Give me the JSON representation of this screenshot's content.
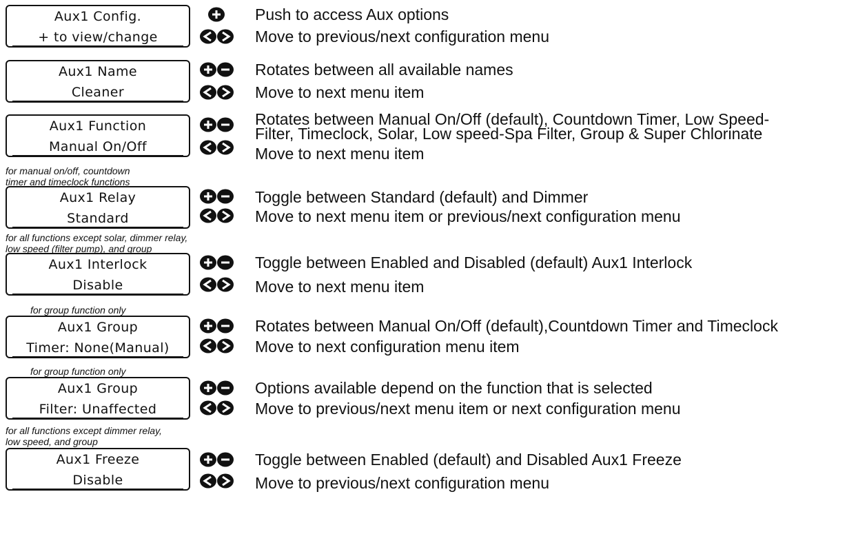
{
  "sections": [
    {
      "note": [],
      "display": {
        "line1": "Aux1 Config.",
        "line2": "+ to view/change"
      },
      "buttons_top": [
        "plus-icon"
      ],
      "desc_top": [
        "Push to access Aux options"
      ],
      "buttons_bottom": [
        "prev-icon",
        "next-icon"
      ],
      "desc_bottom": "Move to previous/next configuration menu"
    },
    {
      "note": [],
      "display": {
        "line1": "Aux1 Name",
        "line2": "Cleaner"
      },
      "buttons_top": [
        "plus-icon",
        "minus-icon"
      ],
      "desc_top": [
        "Rotates between all available names"
      ],
      "buttons_bottom": [
        "prev-icon",
        "next-icon"
      ],
      "desc_bottom": "Move to next menu item"
    },
    {
      "note": [],
      "display": {
        "line1": "Aux1 Function",
        "line2": "Manual On/Off"
      },
      "buttons_top": [
        "plus-icon",
        "minus-icon"
      ],
      "desc_top": [
        "Rotates between Manual On/Off (default), Countdown Timer, Low Speed-",
        "Filter, Timeclock, Solar, Low speed-Spa Filter, Group & Super Chlorinate"
      ],
      "buttons_bottom": [
        "prev-icon",
        "next-icon"
      ],
      "desc_bottom": "Move to next menu item"
    },
    {
      "note": [
        "for manual on/off, countdown",
        "timer and timeclock functions"
      ],
      "display": {
        "line1": "Aux1 Relay",
        "line2": "Standard"
      },
      "buttons_top": [
        "plus-icon",
        "minus-icon"
      ],
      "desc_top": [
        "Toggle between Standard (default) and Dimmer"
      ],
      "buttons_bottom": [
        "prev-icon",
        "next-icon"
      ],
      "desc_bottom": "Move to next menu item or previous/next configuration menu"
    },
    {
      "note": [
        "for all functions except solar, dimmer relay,",
        "low speed (filter pump), and group"
      ],
      "display": {
        "line1": "Aux1 Interlock",
        "line2": "Disable"
      },
      "buttons_top": [
        "plus-icon",
        "minus-icon"
      ],
      "desc_top": [
        "Toggle between Enabled and Disabled (default) Aux1 Interlock"
      ],
      "buttons_bottom": [
        "prev-icon",
        "next-icon"
      ],
      "desc_bottom": "Move to next menu item"
    },
    {
      "note": [
        "for group function only"
      ],
      "display": {
        "line1": "Aux1 Group",
        "line2": "Timer: None(Manual)"
      },
      "buttons_top": [
        "plus-icon",
        "minus-icon"
      ],
      "desc_top": [
        "Rotates between Manual On/Off (default),Countdown Timer and Timeclock"
      ],
      "buttons_bottom": [
        "prev-icon",
        "next-icon"
      ],
      "desc_bottom": "Move to next configuration menu item"
    },
    {
      "note": [
        "for group function only"
      ],
      "display": {
        "line1": "Aux1 Group",
        "line2": "Filter: Unaffected"
      },
      "buttons_top": [
        "plus-icon",
        "minus-icon"
      ],
      "desc_top": [
        "Options available depend on the function that is selected"
      ],
      "buttons_bottom": [
        "prev-icon",
        "next-icon"
      ],
      "desc_bottom": "Move to previous/next menu item or next configuration menu"
    },
    {
      "note": [
        "for all functions except dimmer relay,",
        "low speed, and group"
      ],
      "display": {
        "line1": "Aux1 Freeze",
        "line2": "Disable"
      },
      "buttons_top": [
        "plus-icon",
        "minus-icon"
      ],
      "desc_top": [
        "Toggle between Enabled (default) and Disabled Aux1 Freeze"
      ],
      "buttons_bottom": [
        "prev-icon",
        "next-icon"
      ],
      "desc_bottom": "Move to previous/next configuration menu"
    }
  ]
}
